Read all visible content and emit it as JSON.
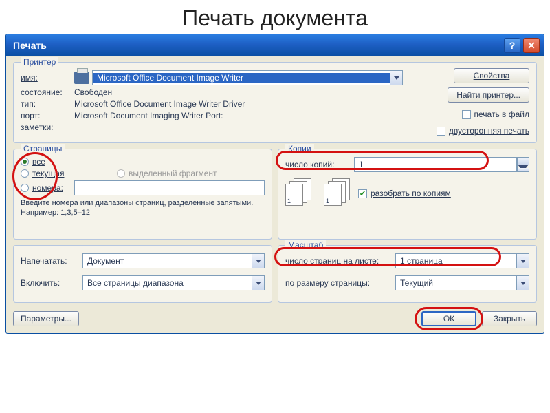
{
  "page_heading": "Печать документа",
  "titlebar": {
    "title": "Печать"
  },
  "printer": {
    "group_title": "Принтер",
    "name_label": "имя:",
    "name_value": "Microsoft Office Document Image Writer",
    "status_label": "состояние:",
    "status_value": "Свободен",
    "type_label": "тип:",
    "type_value": "Microsoft Office Document Image Writer Driver",
    "port_label": "порт:",
    "port_value": "Microsoft Document Imaging Writer Port:",
    "notes_label": "заметки:",
    "properties_btn": "Свойства",
    "find_printer_btn": "Найти принтер...",
    "print_to_file": "печать в файл",
    "duplex": "двусторонняя печать"
  },
  "pages": {
    "group_title": "Страницы",
    "all": "все",
    "current": "текущая",
    "numbers": "номера:",
    "selection": "выделенный фрагмент",
    "hint": "Введите номера или диапазоны страниц, разделенные запятыми. Например: 1,3,5–12"
  },
  "copies": {
    "group_title": "Копии",
    "count_label": "число копий:",
    "count_value": "1",
    "collate": "разобрать по копиям"
  },
  "print_what": {
    "print_label": "Напечатать:",
    "print_value": "Документ",
    "include_label": "Включить:",
    "include_value": "Все страницы диапазона"
  },
  "scale": {
    "group_title": "Масштаб",
    "per_sheet_label": "число страниц на листе:",
    "per_sheet_value": "1 страница",
    "fit_label": "по размеру страницы:",
    "fit_value": "Текущий"
  },
  "footer": {
    "options_btn": "Параметры...",
    "ok_btn": "ОК",
    "close_btn": "Закрыть"
  }
}
